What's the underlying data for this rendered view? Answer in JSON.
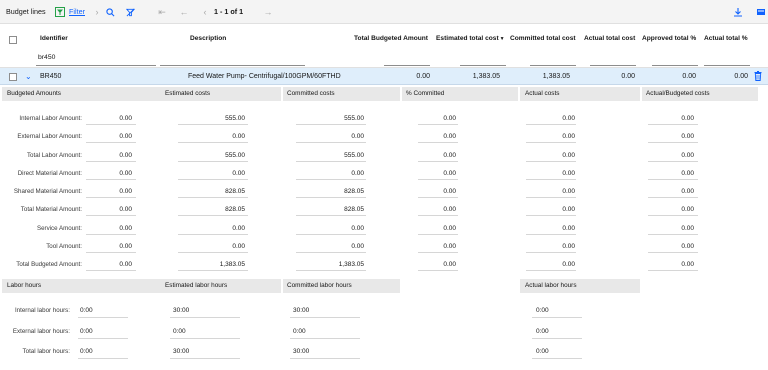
{
  "toolbar": {
    "title": "Budget lines",
    "filter_label": "Filter",
    "pagination": "1 - 1 of 1"
  },
  "columns": {
    "identifier": "Identifier",
    "description": "Description",
    "total_budgeted": "Total Budgeted Amount",
    "estimated_total": "Estimated total cost",
    "committed_total": "Committed total cost",
    "actual_total": "Actual total cost",
    "approved_pct": "Approved total %",
    "actual_pct": "Actual total %"
  },
  "filter": {
    "identifier_value": "br450"
  },
  "row": {
    "identifier": "BR450",
    "description": "Feed Water Pump- Centrifugal/100GPM/60FTHD",
    "total_budgeted": "0.00",
    "estimated_total": "1,383.05",
    "committed_total": "1,383.05",
    "actual_total": "0.00",
    "approved_pct": "0.00",
    "actual_pct": "0.00"
  },
  "amounts": {
    "headers": [
      "Budgeted Amounts",
      "Estimated costs",
      "Committed costs",
      "% Committed",
      "Actual costs",
      "Actual/Budgeted costs"
    ],
    "rows": [
      {
        "label": "Internal Labor Amount:",
        "budgeted": "0.00",
        "estimated": "555.00",
        "committed": "555.00",
        "pct": "0.00",
        "actual": "0.00",
        "actual_budgeted": "0.00"
      },
      {
        "label": "External Labor Amount:",
        "budgeted": "0.00",
        "estimated": "0.00",
        "committed": "0.00",
        "pct": "0.00",
        "actual": "0.00",
        "actual_budgeted": "0.00"
      },
      {
        "label": "Total Labor Amount:",
        "budgeted": "0.00",
        "estimated": "555.00",
        "committed": "555.00",
        "pct": "0.00",
        "actual": "0.00",
        "actual_budgeted": "0.00"
      },
      {
        "label": "Direct Material Amount:",
        "budgeted": "0.00",
        "estimated": "0.00",
        "committed": "0.00",
        "pct": "0.00",
        "actual": "0.00",
        "actual_budgeted": "0.00"
      },
      {
        "label": "Shared Material Amount:",
        "budgeted": "0.00",
        "estimated": "828.05",
        "committed": "828.05",
        "pct": "0.00",
        "actual": "0.00",
        "actual_budgeted": "0.00"
      },
      {
        "label": "Total Material Amount:",
        "budgeted": "0.00",
        "estimated": "828.05",
        "committed": "828.05",
        "pct": "0.00",
        "actual": "0.00",
        "actual_budgeted": "0.00"
      },
      {
        "label": "Service Amount:",
        "budgeted": "0.00",
        "estimated": "0.00",
        "committed": "0.00",
        "pct": "0.00",
        "actual": "0.00",
        "actual_budgeted": "0.00"
      },
      {
        "label": "Tool Amount:",
        "budgeted": "0.00",
        "estimated": "0.00",
        "committed": "0.00",
        "pct": "0.00",
        "actual": "0.00",
        "actual_budgeted": "0.00"
      },
      {
        "label": "Total Budgeted Amount:",
        "budgeted": "0.00",
        "estimated": "1,383.05",
        "committed": "1,383.05",
        "pct": "0.00",
        "actual": "0.00",
        "actual_budgeted": "0.00"
      }
    ]
  },
  "hours": {
    "headers": [
      "Labor hours",
      "Estimated labor hours",
      "Committed labor hours",
      "Actual labor hours"
    ],
    "rows": [
      {
        "label": "Internal labor hours:",
        "labor": "0:00",
        "estimated": "30:00",
        "committed": "30:00",
        "actual": "0:00"
      },
      {
        "label": "External labor hours:",
        "labor": "0:00",
        "estimated": "0:00",
        "committed": "0:00",
        "actual": "0:00"
      },
      {
        "label": "Total labor hours:",
        "labor": "0:00",
        "estimated": "30:00",
        "committed": "30:00",
        "actual": "0:00"
      }
    ]
  },
  "colors": {
    "accent": "#0f62fe",
    "selected_row": "#dfeefb",
    "header_bar": "#e8e8e8"
  }
}
